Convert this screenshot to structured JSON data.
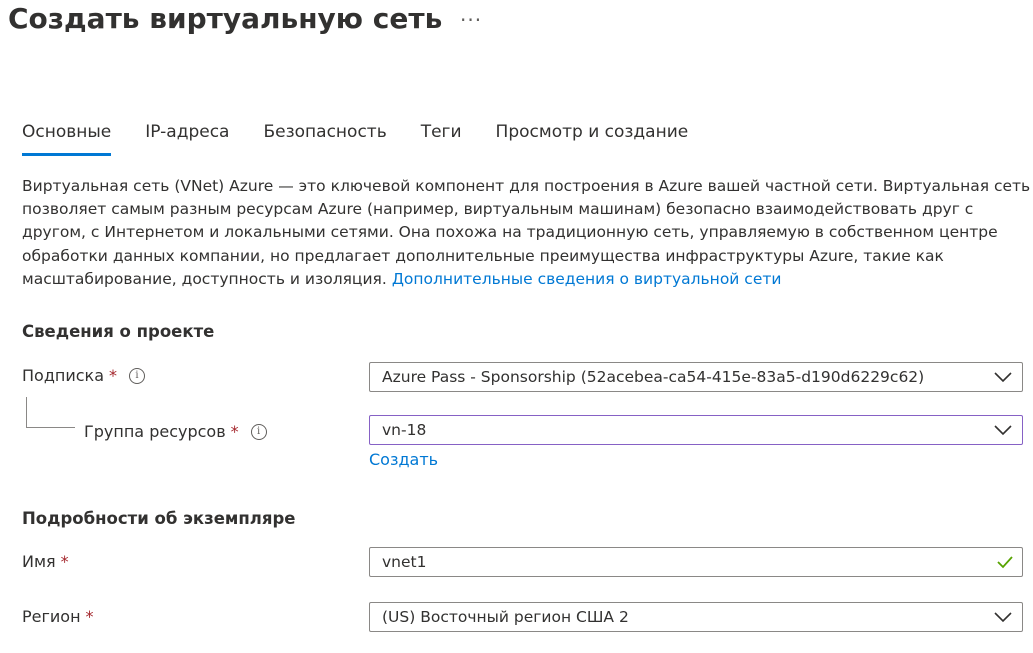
{
  "page": {
    "title": "Создать виртуальную сеть",
    "more_label": "···"
  },
  "tabs": [
    {
      "label": "Основные",
      "active": true
    },
    {
      "label": "IP-адреса",
      "active": false
    },
    {
      "label": "Безопасность",
      "active": false
    },
    {
      "label": "Теги",
      "active": false
    },
    {
      "label": "Просмотр и создание",
      "active": false
    }
  ],
  "description": {
    "text": "Виртуальная сеть (VNet) Azure — это ключевой компонент для построения в Azure вашей частной сети. Виртуальная сеть позволяет самым разным ресурсам Azure (например, виртуальным машинам) безопасно взаимодействовать друг с другом, с Интернетом и локальными сетями. Она похожа на традиционную сеть, управляемую в собственном центре обработки данных компании, но предлагает дополнительные преимущества инфраструктуры Azure, такие как масштабирование, доступность и изоляция.",
    "link_text": "Дополнительные сведения о виртуальной сети"
  },
  "project_details": {
    "heading": "Сведения о проекте",
    "subscription": {
      "label": "Подписка",
      "required_mark": "*",
      "value": "Azure Pass - Sponsorship (52acebea-ca54-415e-83a5-d190d6229c62)"
    },
    "resource_group": {
      "label": "Группа ресурсов",
      "required_mark": "*",
      "value": "vn-18",
      "create_link": "Создать"
    }
  },
  "instance_details": {
    "heading": "Подробности об экземпляре",
    "name": {
      "label": "Имя",
      "required_mark": "*",
      "value": "vnet1"
    },
    "region": {
      "label": "Регион",
      "required_mark": "*",
      "value": "(US) Восточный регион США 2"
    }
  },
  "colors": {
    "accent": "#0078d4",
    "required": "#a4262c",
    "focus_border": "#8661c5",
    "valid_check": "#57a300"
  }
}
